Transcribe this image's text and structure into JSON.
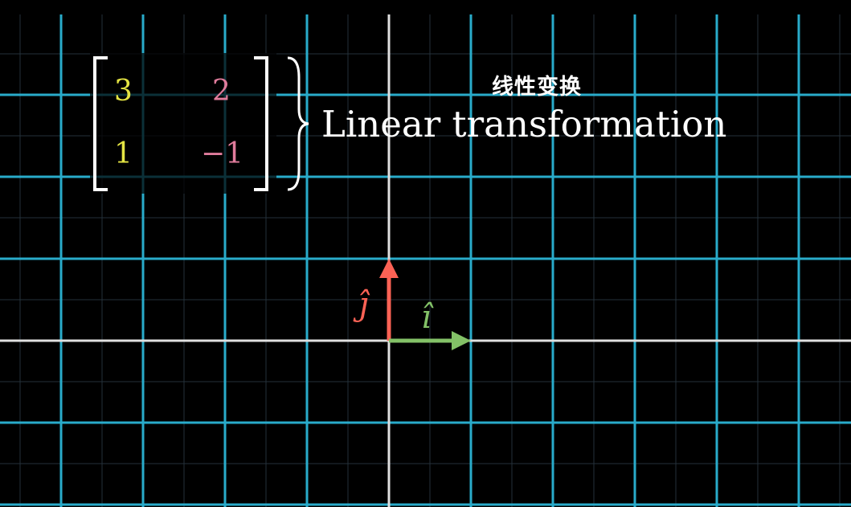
{
  "matrix": {
    "cells": [
      [
        "3",
        "2"
      ],
      [
        "1",
        "−1"
      ]
    ],
    "column_colors": [
      "#e4e443",
      "#e07c9c"
    ]
  },
  "subtitle": {
    "chinese": "线性变换",
    "english": "Linear transformation"
  },
  "basis_vectors": {
    "i_hat": {
      "label": "î",
      "color": "#83c167",
      "vector": [
        1,
        0
      ]
    },
    "j_hat": {
      "label": "ĵ",
      "color": "#fc6255",
      "vector": [
        0,
        1
      ]
    }
  },
  "colors": {
    "background": "#000000",
    "grid_line": "#29abca",
    "axis": "#e0e0e0",
    "bracket": "#ffffff"
  }
}
